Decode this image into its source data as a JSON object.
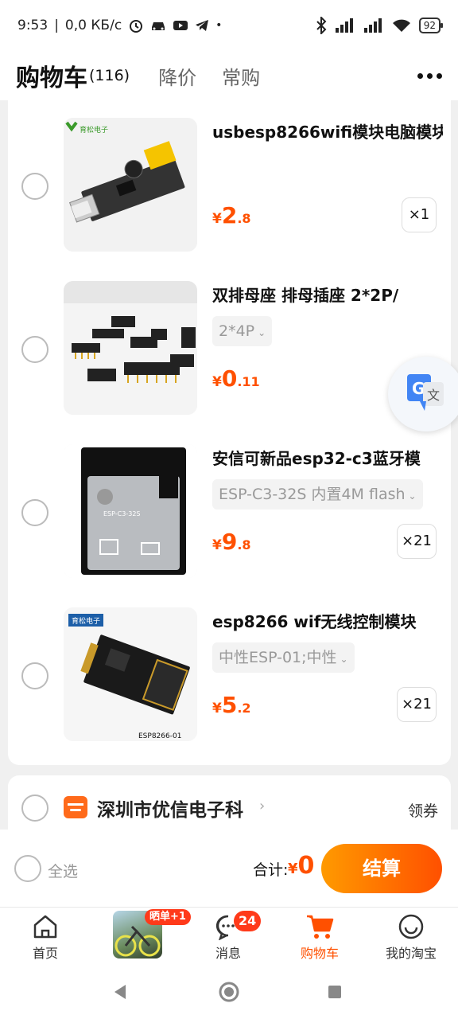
{
  "status_bar": {
    "time": "9:53",
    "network_speed": "0,0 КБ/с",
    "battery": "92"
  },
  "header": {
    "title": "购物车",
    "count": "(116)",
    "tabs": [
      "降价",
      "常购"
    ]
  },
  "items": [
    {
      "name": "usbesp8266wifi模块电脑模块",
      "spec": "",
      "price_int": "2",
      "price_dec": ".8",
      "qty": "×1"
    },
    {
      "name": "双排母座 排母插座 2*2P/",
      "spec": "2*4P",
      "price_int": "0",
      "price_dec": ".11",
      "qty": ""
    },
    {
      "name": "安信可新品esp32-c3蓝牙模",
      "spec": "ESP-C3-32S 内置4M flash",
      "price_int": "9",
      "price_dec": ".8",
      "qty": "×21"
    },
    {
      "name": "esp8266 wif无线控制模块",
      "spec": "中性ESP-01;中性",
      "price_int": "5",
      "price_dec": ".2",
      "qty": "×21"
    }
  ],
  "currency": "¥",
  "thumb_labels": {
    "item1_brand": "育松电子",
    "item3_chip": "ESP-C3-32S",
    "item4_brand": "育松电子",
    "item4_caption": "ESP8266-01"
  },
  "shop": {
    "name": "深圳市优信电子科",
    "coupon": "领券"
  },
  "checkout": {
    "select_all": "全选",
    "total_label": "合计:",
    "total_value": "0",
    "pay_button": "结算"
  },
  "tabbar": {
    "home": "首页",
    "promo_badge": "晒单+1",
    "messages": "消息",
    "messages_badge": "24",
    "cart": "购物车",
    "my": "我的淘宝"
  },
  "colors": {
    "accent": "#ff5000",
    "accent_light": "#ff9a00"
  }
}
